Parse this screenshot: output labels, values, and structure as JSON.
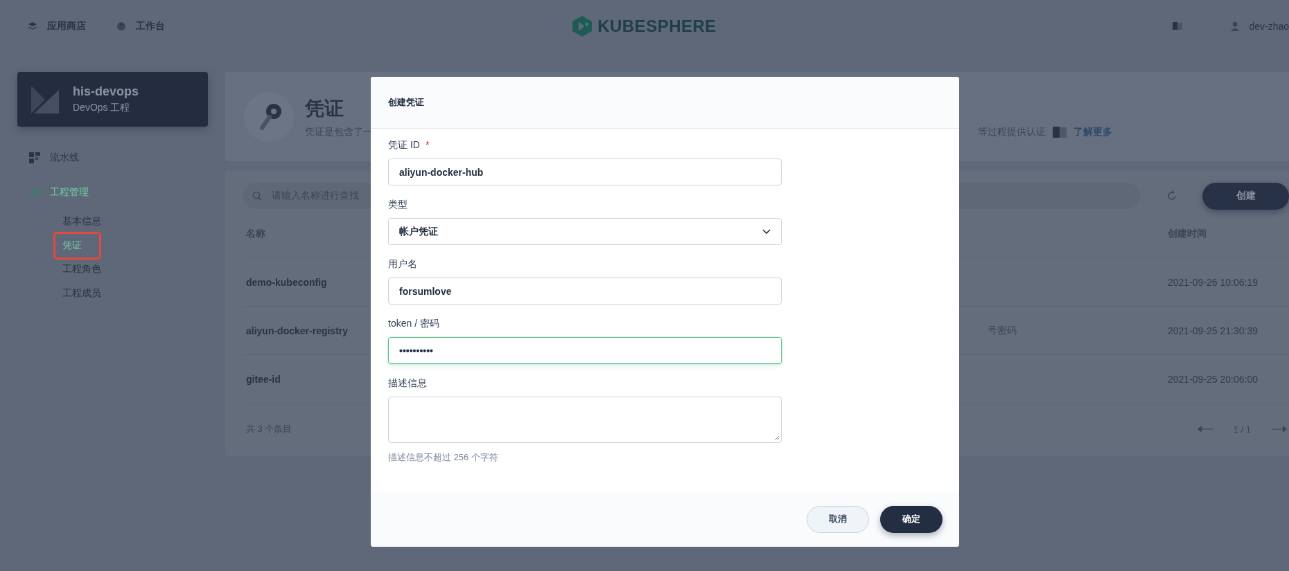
{
  "top_nav": {
    "items": [
      {
        "label": "应用商店",
        "kind": "store"
      },
      {
        "label": "工作台",
        "kind": "workbench"
      }
    ],
    "logo": "KUBESPHERE",
    "user": "dev-zhao"
  },
  "project": {
    "name": "his-devops",
    "subtitle": "DevOps 工程"
  },
  "sidebar": {
    "items": [
      {
        "label": "流水线",
        "kind": "grid",
        "selected": false
      },
      {
        "label": "工程管理",
        "kind": "gear",
        "selected": true,
        "children": [
          {
            "label": "基本信息",
            "selected": false,
            "annotated": false
          },
          {
            "label": "凭证",
            "selected": true,
            "annotated": true
          },
          {
            "label": "工程角色",
            "selected": false,
            "annotated": false
          },
          {
            "label": "工程成员",
            "selected": false,
            "annotated": false
          }
        ]
      }
    ]
  },
  "header": {
    "title": "凭证",
    "description_left": "凭证是包含了一",
    "description_right": "等过程提供认证",
    "learn_more": "了解更多"
  },
  "toolbar": {
    "search": {
      "placeholder": "请输入名称进行查找"
    },
    "create": "创建"
  },
  "table": {
    "columns": [
      {
        "label": "名称"
      },
      {
        "label": "创建时间"
      }
    ],
    "rows": [
      {
        "name": "demo-kubeconfig",
        "created": "2021-09-26 10:06:19"
      },
      {
        "name": "aliyun-docker-registry",
        "column_2": "号密码",
        "created": "2021-09-25 21:30:39"
      },
      {
        "name": "gitee-id",
        "created": "2021-09-25 20:06:00"
      }
    ],
    "total": "共 3 个条目",
    "page": "1 / 1"
  },
  "dialog": {
    "title": "创建凭证",
    "fields": [
      {
        "kind": "text",
        "label": "凭证 ID",
        "required_mark": "*",
        "value": "aliyun-docker-hub",
        "focused": false
      },
      {
        "kind": "select",
        "label": "类型",
        "value": "帐户凭证",
        "focused": false
      },
      {
        "kind": "text",
        "label": "用户名",
        "value": "forsumlove",
        "focused": false
      },
      {
        "kind": "text",
        "label": "token / 密码",
        "value": "••••••••••",
        "focused": true
      },
      {
        "kind": "textarea",
        "label": "描述信息",
        "focused": false,
        "hint": "描述信息不超过 256 个字符"
      }
    ],
    "buttons": [
      {
        "label": "取消",
        "kind": "secondary"
      },
      {
        "label": "确定",
        "kind": "primary"
      }
    ]
  }
}
